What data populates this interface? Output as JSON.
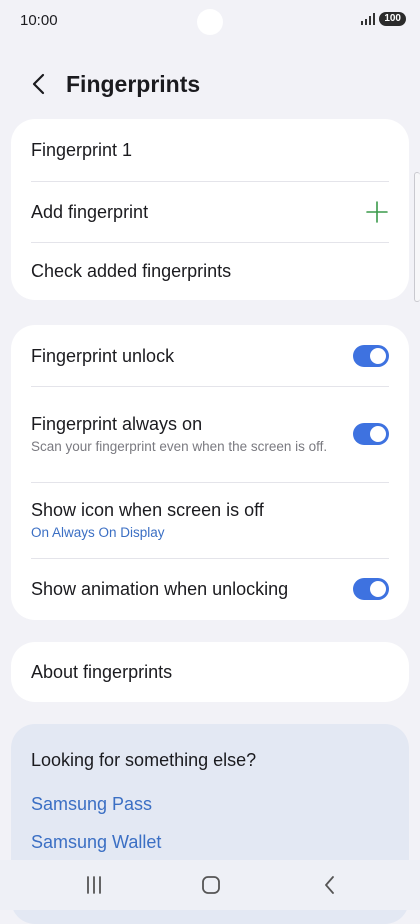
{
  "status": {
    "time": "10:00",
    "battery": "100"
  },
  "header": {
    "title": "Fingerprints"
  },
  "card1": {
    "items": [
      {
        "label": "Fingerprint 1"
      },
      {
        "label": "Add fingerprint"
      },
      {
        "label": "Check added fingerprints"
      }
    ]
  },
  "card2": {
    "items": [
      {
        "label": "Fingerprint unlock",
        "toggle": "on"
      },
      {
        "label": "Fingerprint always on",
        "sub": "Scan your fingerprint even when the screen is off.",
        "toggle": "on"
      },
      {
        "label": "Show icon when screen is off",
        "sub": "On Always On Display"
      },
      {
        "label": "Show animation when unlocking",
        "toggle": "on"
      }
    ]
  },
  "card3": {
    "label": "About fingerprints"
  },
  "suggestions": {
    "title": "Looking for something else?",
    "links": [
      "Samsung Pass",
      "Samsung Wallet"
    ]
  },
  "colors": {
    "accent": "#3e72e0",
    "link": "#3b6fc4",
    "add": "#3a9a4a"
  },
  "icons": [
    "back-arrow-icon",
    "plus-icon",
    "recents-icon",
    "home-icon",
    "nav-back-icon",
    "signal-icon"
  ]
}
